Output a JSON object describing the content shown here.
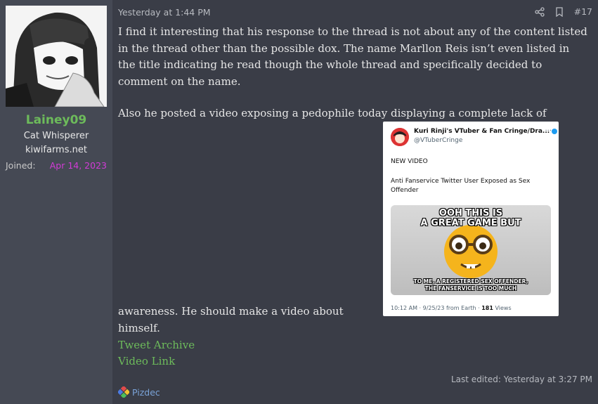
{
  "user": {
    "name": "Lainey09",
    "title": "Cat Whisperer",
    "site": "kiwifarms.net",
    "joined_label": "Joined:",
    "joined_date": "Apr 14, 2023"
  },
  "post": {
    "date": "Yesterday at 1:44 PM",
    "number": "#17",
    "paragraph1": "I find it interesting that his response to the thread is not about any of the content listed in the thread other than the possible dox. The name Marllon Reis isn’t even listed in the title indicating he read though the whole thread and specifically decided to comment on the name.",
    "paragraph2_start": "Also he posted a video exposing a pedophile today displaying a complete lack of",
    "paragraph2_end": "awareness. He should make a video about himself.",
    "links": [
      "Tweet Archive",
      "Video Link"
    ],
    "last_edited": "Last edited: Yesterday at 3:27 PM",
    "reaction_user": "Pizdec"
  },
  "tweet": {
    "display_name": "Kuri Rinji's VTuber & Fan Cringe/Dra...",
    "handle": "@VTuberCringe",
    "line1": "NEW VIDEO",
    "line2": "Anti Fanservice Twitter User Exposed as Sex Offender",
    "meme_top": "OOH THIS IS\nA GREAT GAME BUT",
    "meme_bottom": "TO ME, A REGISTERED SEX OFFENDER,\nTHE FANSERVICE IS TOO MUCH",
    "meta": "10:12 AM · 9/25/23 from Earth ·",
    "views_count": "181",
    "views_label": "Views",
    "more": "···"
  },
  "colors": {
    "username": "#6dbb5b",
    "joined_date": "#d23bd6",
    "link": "#6dbb5b",
    "background": "#3a3d47",
    "sidebar": "#454954"
  },
  "icons": [
    "share-icon",
    "bookmark-icon",
    "verified-badge-icon",
    "reaction-icon"
  ]
}
